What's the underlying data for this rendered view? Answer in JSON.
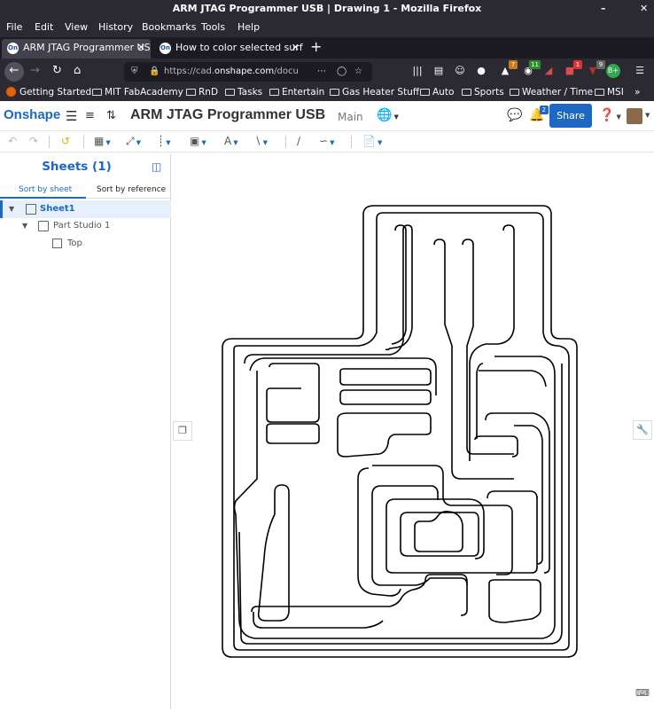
{
  "window": {
    "title": "ARM JTAG Programmer USB | Drawing 1 - Mozilla Firefox"
  },
  "menu": [
    "File",
    "Edit",
    "View",
    "History",
    "Bookmarks",
    "Tools",
    "Help"
  ],
  "tabs": [
    {
      "label": "ARM JTAG Programmer US",
      "favicon": "On"
    },
    {
      "label": "How to color selected surf",
      "favicon": "On"
    }
  ],
  "urlbar": {
    "prefix": "https://cad.",
    "domain": "onshape.com",
    "suffix": "/docu"
  },
  "toolbar_badges": {
    "reader": "7",
    "shield": "11",
    "alerts": "1",
    "ublock": "9"
  },
  "bookmarks": [
    "Getting Started",
    "MIT FabAcademy",
    "RnD",
    "Tasks",
    "Entertain",
    "Gas Heater Stuff",
    "Auto",
    "Sports",
    "Weather / Time",
    "MSI"
  ],
  "app": {
    "logo": "Onshape",
    "doc_title": "ARM JTAG Programmer USB",
    "branch": "Main",
    "share_label": "Share",
    "notifications": "2"
  },
  "panel": {
    "title": "Sheets (1)",
    "sort_by_sheet": "Sort by sheet",
    "sort_by_reference": "Sort by reference",
    "tree": [
      {
        "label": "Sheet1"
      },
      {
        "label": "Part Studio 1"
      },
      {
        "label": "Top"
      }
    ]
  },
  "icons": {
    "back": "back-arrow-icon",
    "forward": "forward-arrow-icon",
    "reload": "reload-icon",
    "home": "home-icon",
    "comment": "comment-icon",
    "bell": "bell-icon",
    "help": "help-icon",
    "wrench": "wrench-icon"
  }
}
